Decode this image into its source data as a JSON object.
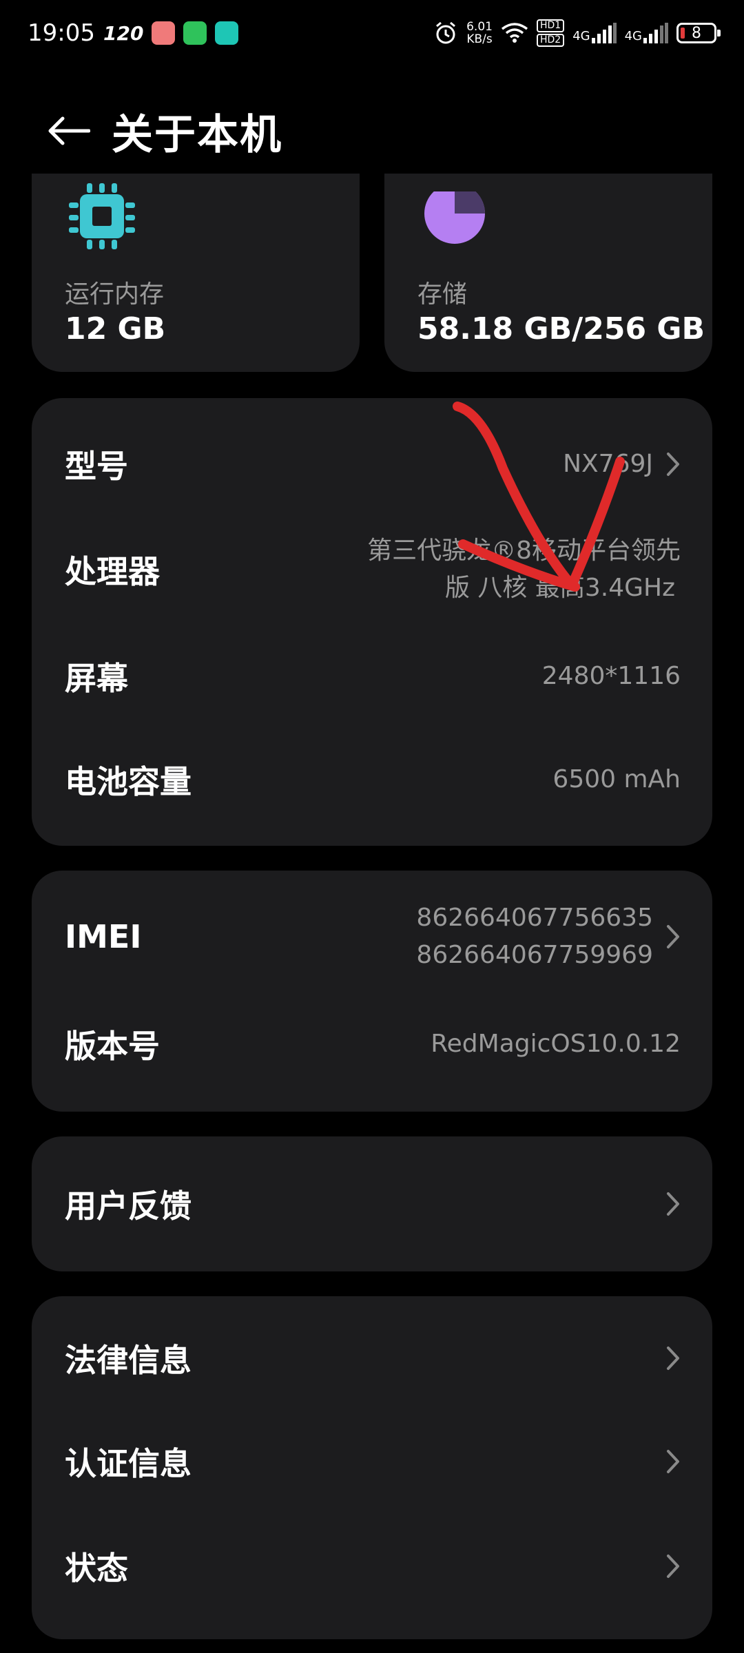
{
  "status_bar": {
    "time": "19:05",
    "refresh_rate": "120",
    "net_speed_value": "6.01",
    "net_speed_unit": "KB/s",
    "hd1": "HD1",
    "hd2": "HD2",
    "signal1": "4G",
    "signal2": "4G",
    "battery_level": "8"
  },
  "header": {
    "title": "关于本机"
  },
  "specs": {
    "memory": {
      "label": "运行内存",
      "value": "12 GB"
    },
    "storage": {
      "label": "存储",
      "value": "58.18 GB/256 GB"
    }
  },
  "device_info": {
    "model": {
      "label": "型号",
      "value": "NX769J"
    },
    "processor": {
      "label": "处理器",
      "value_line1": "第三代骁龙®8移动平台领先",
      "value_line2": "版 八核 最高3.4GHz"
    },
    "screen": {
      "label": "屏幕",
      "value": "2480*1116"
    },
    "battery": {
      "label": "电池容量",
      "value": "6500 mAh"
    }
  },
  "identity": {
    "imei": {
      "label": "IMEI",
      "value1": "862664067756635",
      "value2": "862664067759969"
    },
    "version": {
      "label": "版本号",
      "value": "RedMagicOS10.0.12"
    }
  },
  "feedback": {
    "label": "用户反馈"
  },
  "legal": {
    "legal_info": {
      "label": "法律信息"
    },
    "certification": {
      "label": "认证信息"
    },
    "status": {
      "label": "状态"
    }
  },
  "colors": {
    "background": "#000000",
    "card": "#1c1c1e",
    "secondary_text": "#9a9a9a",
    "cpu_icon": "#3fc7d2",
    "storage_icon": "#b57ff2",
    "annotation": "#e02a2a"
  }
}
